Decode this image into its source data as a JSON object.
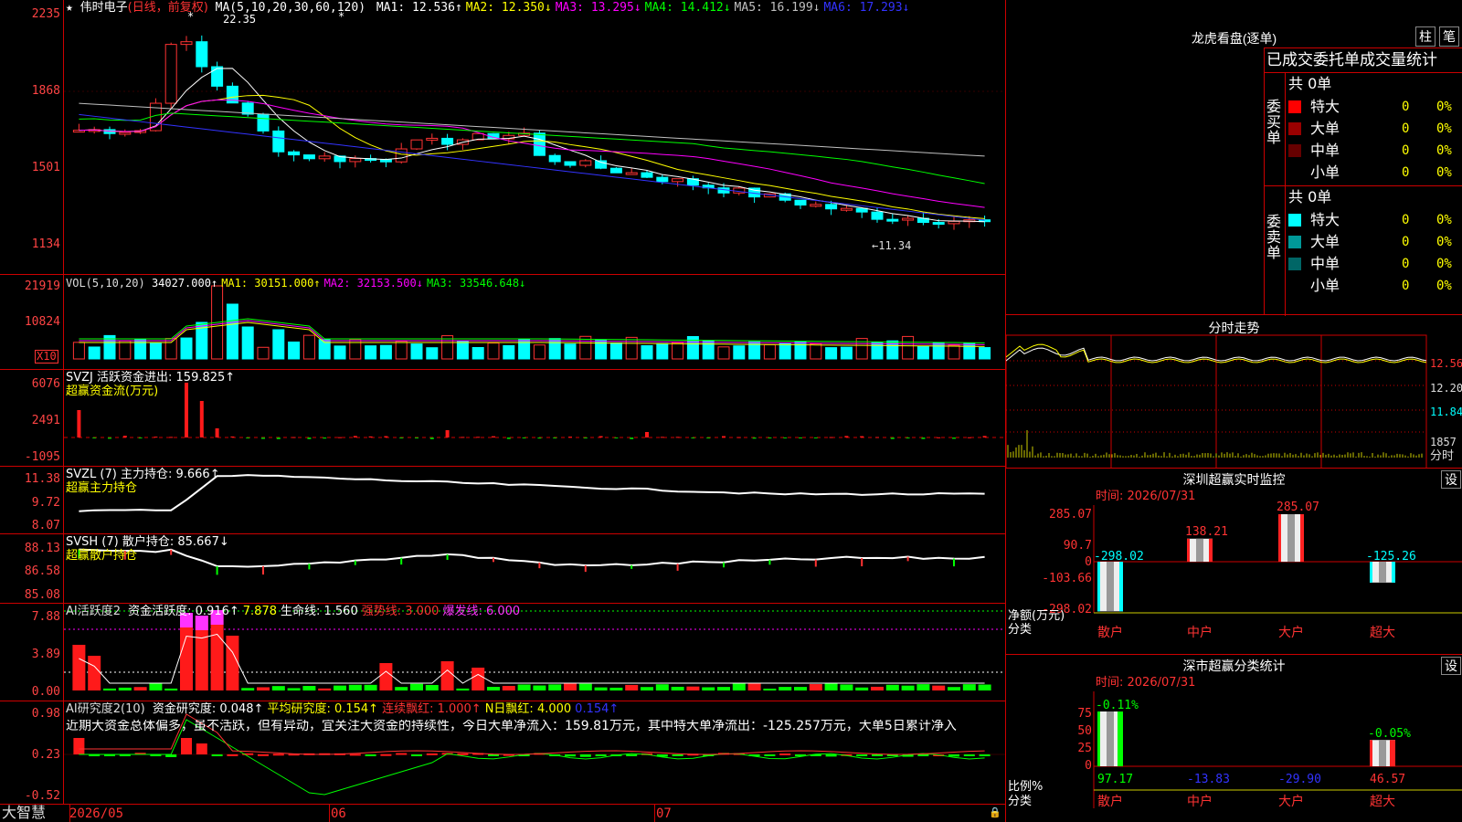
{
  "stock": {
    "name": "伟时电子",
    "mode": "(日线，前复权)",
    "ma_prefix": "MA(5,10,20,30,60,120)",
    "ma": [
      {
        "label": "MA1: 12.536↑",
        "color": "#ffffff"
      },
      {
        "label": "MA2: 12.350↓",
        "color": "#ffff00"
      },
      {
        "label": "MA3: 13.295↓",
        "color": "#ff00ff"
      },
      {
        "label": "MA4: 14.412↓",
        "color": "#00ff00"
      },
      {
        "label": "MA5: 16.199↓",
        "color": "#c0c0c0"
      },
      {
        "label": "MA6: 17.293↓",
        "color": "#3333ff"
      }
    ],
    "y_ticks": [
      "2235",
      "1868",
      "1501",
      "1134"
    ],
    "high_label": "22.35",
    "low_label": "←11.34"
  },
  "vol": {
    "title": "VOL(5,10,20)",
    "value": "34027.000↑",
    "ma": [
      {
        "label": "MA1: 30151.000↑",
        "color": "#ffff00"
      },
      {
        "label": "MA2: 32153.500↓",
        "color": "#ff00ff"
      },
      {
        "label": "MA3: 33546.648↓",
        "color": "#00ff00"
      }
    ],
    "y_ticks": [
      "21919",
      "10824"
    ],
    "unit": "X10"
  },
  "svzj": {
    "title": "SVZJ  活跃资金进出: 159.825↑",
    "subtitle": "超赢资金流(万元)",
    "y_ticks": [
      "6076",
      "2491",
      "-1095"
    ]
  },
  "svzl": {
    "title": "SVZL (7) 主力持仓: 9.666↑",
    "subtitle": "超赢主力持仓",
    "y_ticks": [
      "11.38",
      "9.72",
      "8.07"
    ]
  },
  "svsh": {
    "title": "SVSH (7) 散户持仓: 85.667↓",
    "subtitle": "超赢散户持仓",
    "y_ticks": [
      "88.13",
      "86.58",
      "85.08"
    ]
  },
  "ai1": {
    "title": "AI活跃度2",
    "items": [
      {
        "label": "资金活跃度: 0.916↑",
        "color": "#ffffff"
      },
      {
        "label": "7.878",
        "color": "#ffff00"
      },
      {
        "label": "生命线: 1.560",
        "color": "#ffffff"
      },
      {
        "label": "强势线: 3.000",
        "color": "#ff3333"
      },
      {
        "label": "爆发线: 6.000",
        "color": "#ff33ff"
      }
    ],
    "y_ticks": [
      "7.88",
      "3.89",
      "0.00"
    ]
  },
  "ai2": {
    "title": "AI研究度2(10)",
    "items": [
      {
        "label": "资金研究度: 0.048↑",
        "color": "#ffffff"
      },
      {
        "label": "平均研究度: 0.154↑",
        "color": "#ffff00"
      },
      {
        "label": "连续飘红: 1.000↑",
        "color": "#ff3333"
      },
      {
        "label": "N日飘红: 4.000",
        "color": "#ffff00"
      },
      {
        "label": "0.154↑",
        "color": "#3333ff"
      }
    ],
    "note": "近期大资金总体偏多，虽不活跃，但有异动，宜关注大资金的持续性，今日大单净流入：159.81万元，其中特大单净流出：-125.257万元，大单5日累计净入",
    "y_ticks": [
      "0.98",
      "0.23",
      "-0.52"
    ]
  },
  "xaxis": {
    "brand": "大智慧",
    "labels": [
      "2026/05",
      "06",
      "07"
    ]
  },
  "lhkp": {
    "title": "龙虎看盘(逐单)",
    "btn_a": "柱",
    "btn_b": "笔",
    "header": "已成交委托单成交量统计",
    "buy": {
      "side": "委买单",
      "total": "共 0单",
      "rows": [
        {
          "label": "特大",
          "count": "0",
          "pct": "0%",
          "color": "#ff0000"
        },
        {
          "label": "大单",
          "count": "0",
          "pct": "0%",
          "color": "#990000"
        },
        {
          "label": "中单",
          "count": "0",
          "pct": "0%",
          "color": "#660000"
        },
        {
          "label": "小单",
          "count": "0",
          "pct": "0%",
          "color": "#000000"
        }
      ]
    },
    "sell": {
      "side": "委卖单",
      "total": "共 0单",
      "rows": [
        {
          "label": "特大",
          "count": "0",
          "pct": "0%",
          "color": "#00ffff"
        },
        {
          "label": "大单",
          "count": "0",
          "pct": "0%",
          "color": "#009999"
        },
        {
          "label": "中单",
          "count": "0",
          "pct": "0%",
          "color": "#006666"
        },
        {
          "label": "小单",
          "count": "0",
          "pct": "0%",
          "color": "#000000"
        }
      ]
    }
  },
  "fenshi": {
    "title": "分时走势",
    "y_ticks": [
      "12.56",
      "12.20",
      "11.84"
    ],
    "vol_tick": "1857",
    "vol_unit": "分时"
  },
  "monitor": {
    "title": "深圳超赢实时监控",
    "btn": "设",
    "time": "时间: 2026/07/31",
    "y_ticks": [
      "285.07",
      "90.7",
      "0",
      "-103.66",
      "-298.02"
    ],
    "axis_label": "净额(万元)",
    "cat_label": "分类",
    "bars": [
      {
        "cat": "散户",
        "value": -298.02,
        "label": "-298.02"
      },
      {
        "cat": "中户",
        "value": 138.21,
        "label": "138.21"
      },
      {
        "cat": "大户",
        "value": 285.07,
        "label": "285.07"
      },
      {
        "cat": "超大",
        "value": -125.26,
        "label": "-125.26"
      }
    ]
  },
  "classify": {
    "title": "深市超赢分类统计",
    "btn": "设",
    "time": "时间: 2026/07/31",
    "y_ticks": [
      "75",
      "50",
      "25",
      "0"
    ],
    "axis_label": "比例%",
    "cat_label": "分类",
    "bars": [
      {
        "cat": "散户",
        "value": 97.17,
        "top": "-0.11%",
        "bottom": "97.17"
      },
      {
        "cat": "中户",
        "value": 0,
        "top": "",
        "bottom": "-13.83"
      },
      {
        "cat": "大户",
        "value": 0,
        "top": "",
        "bottom": "-29.90"
      },
      {
        "cat": "超大",
        "value": 46.57,
        "top": "-0.05%",
        "bottom": "46.57"
      }
    ]
  }
}
